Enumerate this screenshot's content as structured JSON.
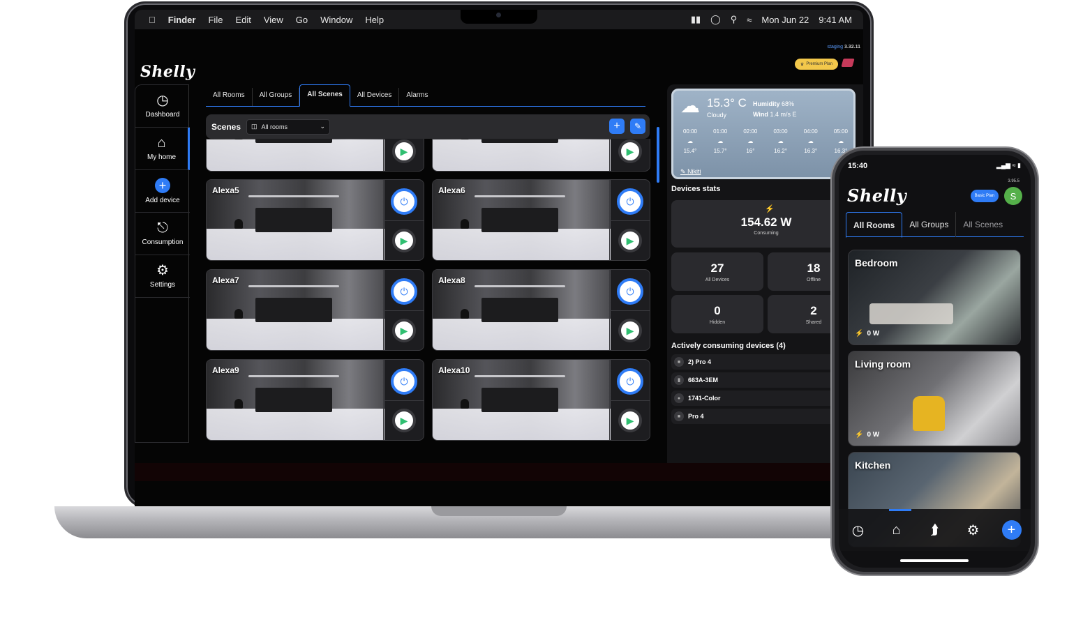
{
  "menubar": {
    "apple": "",
    "items": [
      "Finder",
      "File",
      "Edit",
      "View",
      "Go",
      "Window",
      "Help"
    ],
    "date": "Mon Jun 22",
    "time": "9:41 AM"
  },
  "app": {
    "logo": "Shelly",
    "staging_label": "staging",
    "version": "3.32.11",
    "plan": "Premium Plan",
    "sidebar": [
      {
        "label": "Dashboard",
        "icon": "dashboard-icon"
      },
      {
        "label": "My home",
        "icon": "home-icon"
      },
      {
        "label": "Add device",
        "icon": "add-icon"
      },
      {
        "label": "Consumption",
        "icon": "plug-icon"
      },
      {
        "label": "Settings",
        "icon": "gear-icon"
      }
    ],
    "tabs": [
      "All Rooms",
      "All Groups",
      "All Scenes",
      "All Devices",
      "Alarms"
    ],
    "scenes": {
      "title": "Scenes",
      "room_filter": "All rooms",
      "cards": [
        "",
        "",
        "Alexa5",
        "Alexa6",
        "Alexa7",
        "Alexa8",
        "Alexa9",
        "Alexa10"
      ]
    },
    "weather": {
      "temp": "15.3° C",
      "desc": "Cloudy",
      "humidity_label": "Humidity",
      "humidity": "68%",
      "wind_label": "Wind",
      "wind": "1.4 m/s E",
      "hours": [
        {
          "time": "00:00",
          "temp": "15.4°"
        },
        {
          "time": "01:00",
          "temp": "15.7°"
        },
        {
          "time": "02:00",
          "temp": "16°"
        },
        {
          "time": "03:00",
          "temp": "16.2°"
        },
        {
          "time": "04:00",
          "temp": "16.3°"
        },
        {
          "time": "05:00",
          "temp": "16.3°"
        }
      ],
      "location": "Nikiti"
    },
    "stats": {
      "title": "Devices stats",
      "consuming_value": "154.62 W",
      "consuming_label": "Consuming",
      "all_devices_value": "27",
      "all_devices_label": "All Devices",
      "offline_value": "18",
      "offline_label": "Offline",
      "hidden_value": "0",
      "hidden_label": "Hidden",
      "shared_value": "2",
      "shared_label": "Shared"
    },
    "consuming": {
      "title": "Actively consuming devices (4)",
      "devices": [
        "2) Pro 4",
        "663A-3EM",
        "1741-Color",
        "Pro 4"
      ]
    }
  },
  "phone": {
    "time": "15:40",
    "version": "3.95.5",
    "plan": "Basic Plan",
    "avatar": "S",
    "logo": "Shelly",
    "tabs": [
      "All Rooms",
      "All Groups",
      "All Scenes"
    ],
    "rooms": [
      {
        "name": "Bedroom",
        "power": "0 W"
      },
      {
        "name": "Living room",
        "power": "0 W"
      },
      {
        "name": "Kitchen",
        "power": ""
      }
    ]
  }
}
